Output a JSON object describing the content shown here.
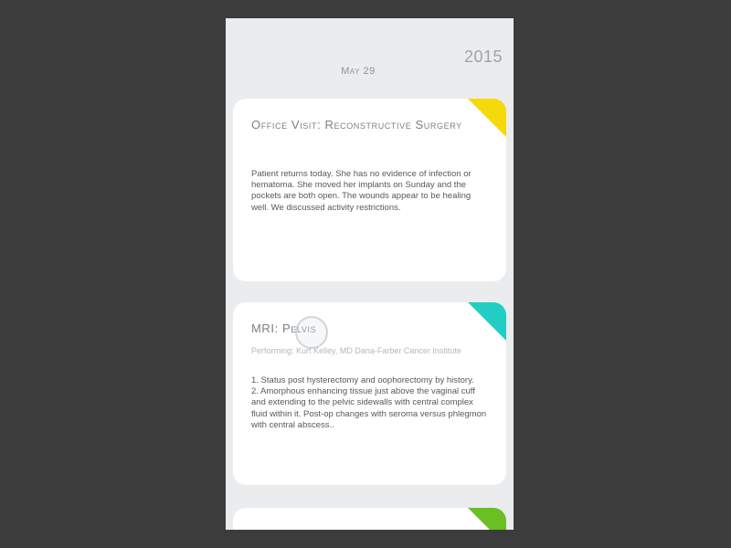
{
  "header": {
    "year": "2015",
    "date": "May 29"
  },
  "cards": [
    {
      "title": "Office Visit: Reconstructive Surgery",
      "body": "Patient returns today. She has no evidence of infection or hematoma. She moved her implants on Sunday and the pockets are both open. The wounds appear to be healing well. We discussed activity restrictions.",
      "corner_color": "#f5d90a"
    },
    {
      "title": "MRI: Pelvis",
      "subtitle": "Performing: Kurt Kelley, MD  Dana-Farber Cancer Institute",
      "body_items": [
        "1.   Status post hysterectomy and oophorectomy by history.",
        "2.   Amorphous enhancing tissue just above the vaginal cuff and extending to the pelvic sidewalls with central complex fluid within it. Post-op changes with seroma versus phlegmon with central abscess.."
      ],
      "corner_color": "#22cdc3"
    },
    {
      "corner_color": "#6abf23"
    }
  ],
  "colors": {
    "background": "#3c3c3c",
    "screen": "#eaecee",
    "card": "#ffffff"
  }
}
